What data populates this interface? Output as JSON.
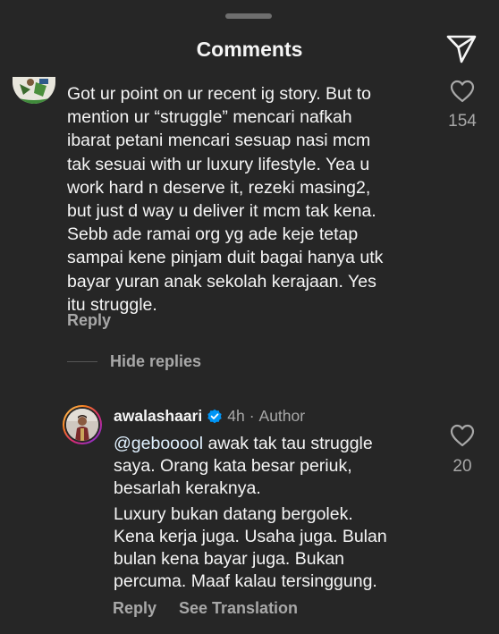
{
  "header": {
    "title": "Comments",
    "share_icon": "paper-plane-icon"
  },
  "comment": {
    "text": "Got ur point on ur recent ig story. But to\nmention ur “struggle” mencari nafkah\nibarat petani mencari sesuap nasi mcm\ntak sesuai with ur luxury lifestyle. Yea u\nwork hard n deserve it, rezeki masing2,\nbut just d way u deliver it mcm tak kena.\nSebb ade ramai org yg ade keje tetap\nsampai kene pinjam duit bagai hanya utk\nbayar yuran anak sekolah kerajaan. Yes\nitu struggle.",
    "likes": "154",
    "reply_label": "Reply",
    "hide_replies_label": "Hide replies"
  },
  "reply": {
    "username": "awalashaari",
    "time": "4h",
    "separator": "·",
    "author_badge": "Author",
    "mention": "@gebooool",
    "paragraph1_rest": " awak tak tau struggle\nsaya. Orang kata besar periuk,\nbesarlah keraknya.",
    "paragraph2": "Luxury bukan datang bergolek.\nKena kerja juga. Usaha juga. Bulan\nbulan kena bayar juga. Bukan\npercuma. Maaf kalau tersinggung.",
    "likes": "20",
    "reply_label": "Reply",
    "translation_label": "See Translation"
  },
  "colors": {
    "background": "#262626",
    "text_primary": "#f5f5f5",
    "text_secondary": "#a8a8a8",
    "verified_blue": "#0095f6"
  }
}
